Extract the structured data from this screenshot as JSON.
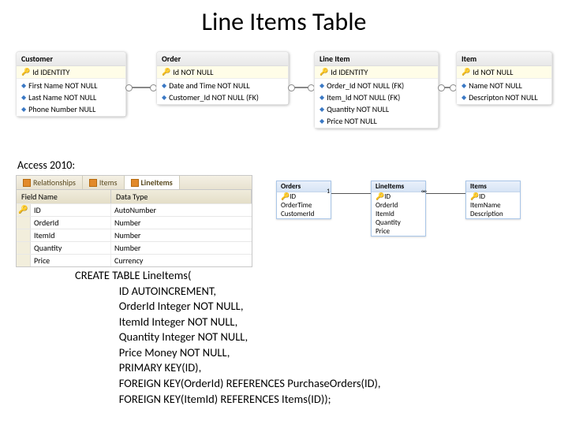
{
  "title": "Line Items Table",
  "erd": {
    "customer": {
      "name": "Customer",
      "pk": "Id  IDENTITY",
      "fields": [
        "First Name  NOT NULL",
        "Last Name  NOT NULL",
        "Phone Number  NULL"
      ]
    },
    "order": {
      "name": "Order",
      "pk": "Id  NOT NULL",
      "fields": [
        "Date and Time  NOT NULL",
        "Customer_Id  NOT NULL (FK)"
      ]
    },
    "lineitem": {
      "name": "Line Item",
      "pk": "Id  IDENTITY",
      "fields": [
        "Order_Id  NOT NULL (FK)",
        "Item_Id  NOT NULL (FK)",
        "Quantity  NOT NULL",
        "Price  NOT NULL"
      ]
    },
    "item": {
      "name": "Item",
      "pk": "Id  NOT NULL",
      "fields": [
        "Name  NOT NULL",
        "Descripton  NOT NULL"
      ]
    }
  },
  "access_label": "Access 2010:",
  "tabs": {
    "t1": "Relationships",
    "t2": "Items",
    "t3": "LineItems"
  },
  "grid": {
    "h1": "Field Name",
    "h2": "Data Type",
    "rows": [
      {
        "k": "🔑",
        "n": "ID",
        "t": "AutoNumber"
      },
      {
        "k": "",
        "n": "OrderId",
        "t": "Number"
      },
      {
        "k": "",
        "n": "ItemId",
        "t": "Number"
      },
      {
        "k": "",
        "n": "Quantity",
        "t": "Number"
      },
      {
        "k": "",
        "n": "Price",
        "t": "Currency"
      }
    ]
  },
  "rel": {
    "orders": {
      "name": "Orders",
      "pk": "ID",
      "rows": [
        "OrderTime",
        "CustomerId"
      ]
    },
    "lineitems": {
      "name": "LineItems",
      "pk": "ID",
      "rows": [
        "OrderId",
        "ItemId",
        "Quantity",
        "Price"
      ]
    },
    "items": {
      "name": "Items",
      "pk": "ID",
      "rows": [
        "ItemName",
        "Description"
      ]
    },
    "one": "1",
    "many": "∞"
  },
  "sql_lines": [
    "CREATE TABLE LineItems(",
    "                 ID AUTOINCREMENT,",
    "                 OrderId Integer NOT NULL,",
    "                 ItemId Integer NOT NULL,",
    "                 Quantity Integer NOT NULL,",
    "                 Price Money NOT NULL,",
    "                 PRIMARY KEY(ID),",
    "                 FOREIGN KEY(OrderId) REFERENCES PurchaseOrders(ID),",
    "                 FOREIGN KEY(ItemId) REFERENCES Items(ID));"
  ]
}
